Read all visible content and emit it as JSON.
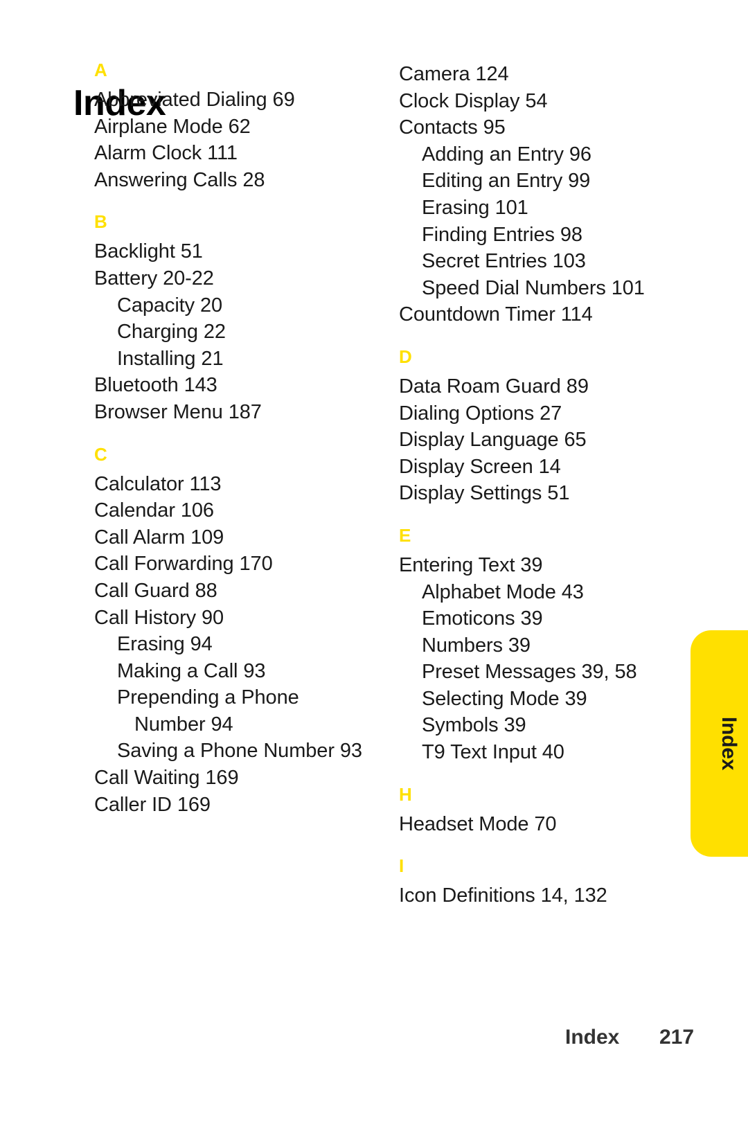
{
  "page_title": "Index",
  "side_tab": {
    "label": "Index"
  },
  "footer": {
    "label": "Index",
    "page_number": "217"
  },
  "colors": {
    "accent_yellow": "#FFE000",
    "text": "#1a1a1a",
    "footer_text": "#333333"
  },
  "columns": [
    {
      "name": "left-column",
      "sections": [
        {
          "letter": "A",
          "entries": [
            {
              "text": "Abbreviated Dialing 69",
              "level": 0
            },
            {
              "text": "Airplane Mode 62",
              "level": 0
            },
            {
              "text": "Alarm Clock 111",
              "level": 0
            },
            {
              "text": "Answering Calls 28",
              "level": 0
            }
          ]
        },
        {
          "letter": "B",
          "entries": [
            {
              "text": "Backlight 51",
              "level": 0
            },
            {
              "text": "Battery 20-22",
              "level": 0
            },
            {
              "text": "Capacity 20",
              "level": 1
            },
            {
              "text": "Charging 22",
              "level": 1
            },
            {
              "text": "Installing 21",
              "level": 1
            },
            {
              "text": "Bluetooth 143",
              "level": 0
            },
            {
              "text": "Browser Menu 187",
              "level": 0
            }
          ]
        },
        {
          "letter": "C",
          "entries": [
            {
              "text": "Calculator 113",
              "level": 0
            },
            {
              "text": "Calendar 106",
              "level": 0
            },
            {
              "text": "Call Alarm 109",
              "level": 0
            },
            {
              "text": "Call Forwarding 170",
              "level": 0
            },
            {
              "text": "Call Guard 88",
              "level": 0
            },
            {
              "text": "Call History 90",
              "level": 0
            },
            {
              "text": "Erasing 94",
              "level": 1
            },
            {
              "text": "Making a Call 93",
              "level": 1
            },
            {
              "text": "Prepending a Phone Number 94",
              "level": 1
            },
            {
              "text": "Saving a Phone Number 93",
              "level": 1
            },
            {
              "text": "Call Waiting 169",
              "level": 0
            },
            {
              "text": "Caller ID 169",
              "level": 0
            }
          ]
        }
      ]
    },
    {
      "name": "right-column",
      "sections": [
        {
          "letter": "",
          "entries": [
            {
              "text": "Camera 124",
              "level": 0
            },
            {
              "text": "Clock Display 54",
              "level": 0
            },
            {
              "text": "Contacts 95",
              "level": 0
            },
            {
              "text": "Adding an Entry 96",
              "level": 1
            },
            {
              "text": "Editing an Entry 99",
              "level": 1
            },
            {
              "text": "Erasing 101",
              "level": 1
            },
            {
              "text": "Finding Entries 98",
              "level": 1
            },
            {
              "text": "Secret Entries 103",
              "level": 1
            },
            {
              "text": "Speed Dial Numbers 101",
              "level": 1
            },
            {
              "text": "Countdown Timer 114",
              "level": 0
            }
          ]
        },
        {
          "letter": "D",
          "entries": [
            {
              "text": "Data Roam Guard 89",
              "level": 0
            },
            {
              "text": "Dialing Options 27",
              "level": 0
            },
            {
              "text": "Display Language 65",
              "level": 0
            },
            {
              "text": "Display Screen 14",
              "level": 0
            },
            {
              "text": "Display Settings 51",
              "level": 0
            }
          ]
        },
        {
          "letter": "E",
          "entries": [
            {
              "text": "Entering Text 39",
              "level": 0
            },
            {
              "text": "Alphabet Mode 43",
              "level": 1
            },
            {
              "text": "Emoticons 39",
              "level": 1
            },
            {
              "text": "Numbers 39",
              "level": 1
            },
            {
              "text": "Preset Messages 39, 58",
              "level": 1
            },
            {
              "text": "Selecting Mode 39",
              "level": 1
            },
            {
              "text": "Symbols 39",
              "level": 1
            },
            {
              "text": "T9 Text Input 40",
              "level": 1
            }
          ]
        },
        {
          "letter": "H",
          "entries": [
            {
              "text": "Headset Mode 70",
              "level": 0
            }
          ]
        },
        {
          "letter": "I",
          "entries": [
            {
              "text": "Icon Definitions 14, 132",
              "level": 0
            }
          ]
        }
      ]
    }
  ]
}
